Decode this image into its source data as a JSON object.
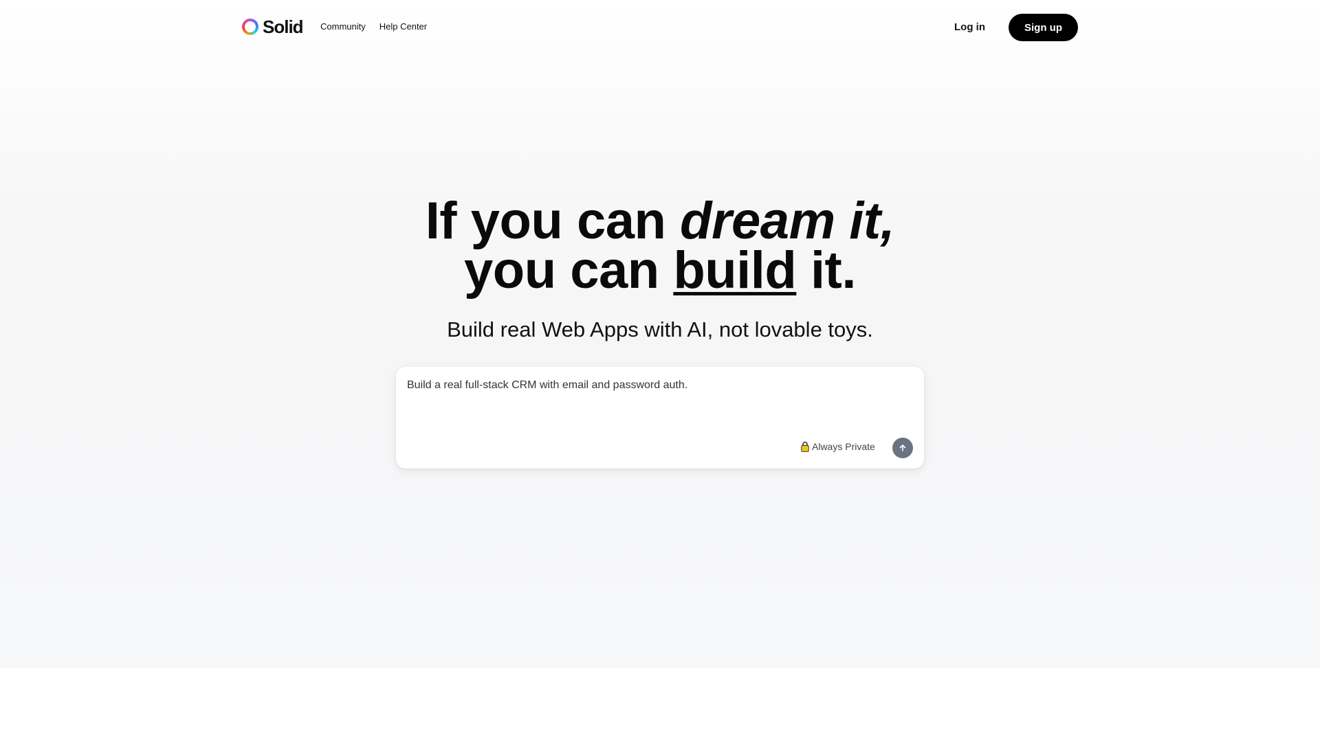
{
  "brand": {
    "name": "Solid"
  },
  "nav": {
    "items": [
      {
        "label": "Community"
      },
      {
        "label": "Help Center"
      }
    ]
  },
  "auth": {
    "login_label": "Log in",
    "signup_label": "Sign up"
  },
  "hero": {
    "line1_prefix": "If you can ",
    "line1_emphasis": "dream it,",
    "line2_prefix": "you can ",
    "line2_underlined": "build",
    "line2_suffix": " it.",
    "subtitle": "Build real Web Apps with AI, not lovable toys."
  },
  "prompt": {
    "value": "Build a real full-stack CRM with email and password auth.",
    "privacy_label": "Always Private",
    "lock_icon": "lock-icon",
    "send_icon": "arrow-up-icon"
  },
  "colors": {
    "accent": "#000000",
    "send_button": "#6b7280",
    "lock": "#f5c518"
  }
}
